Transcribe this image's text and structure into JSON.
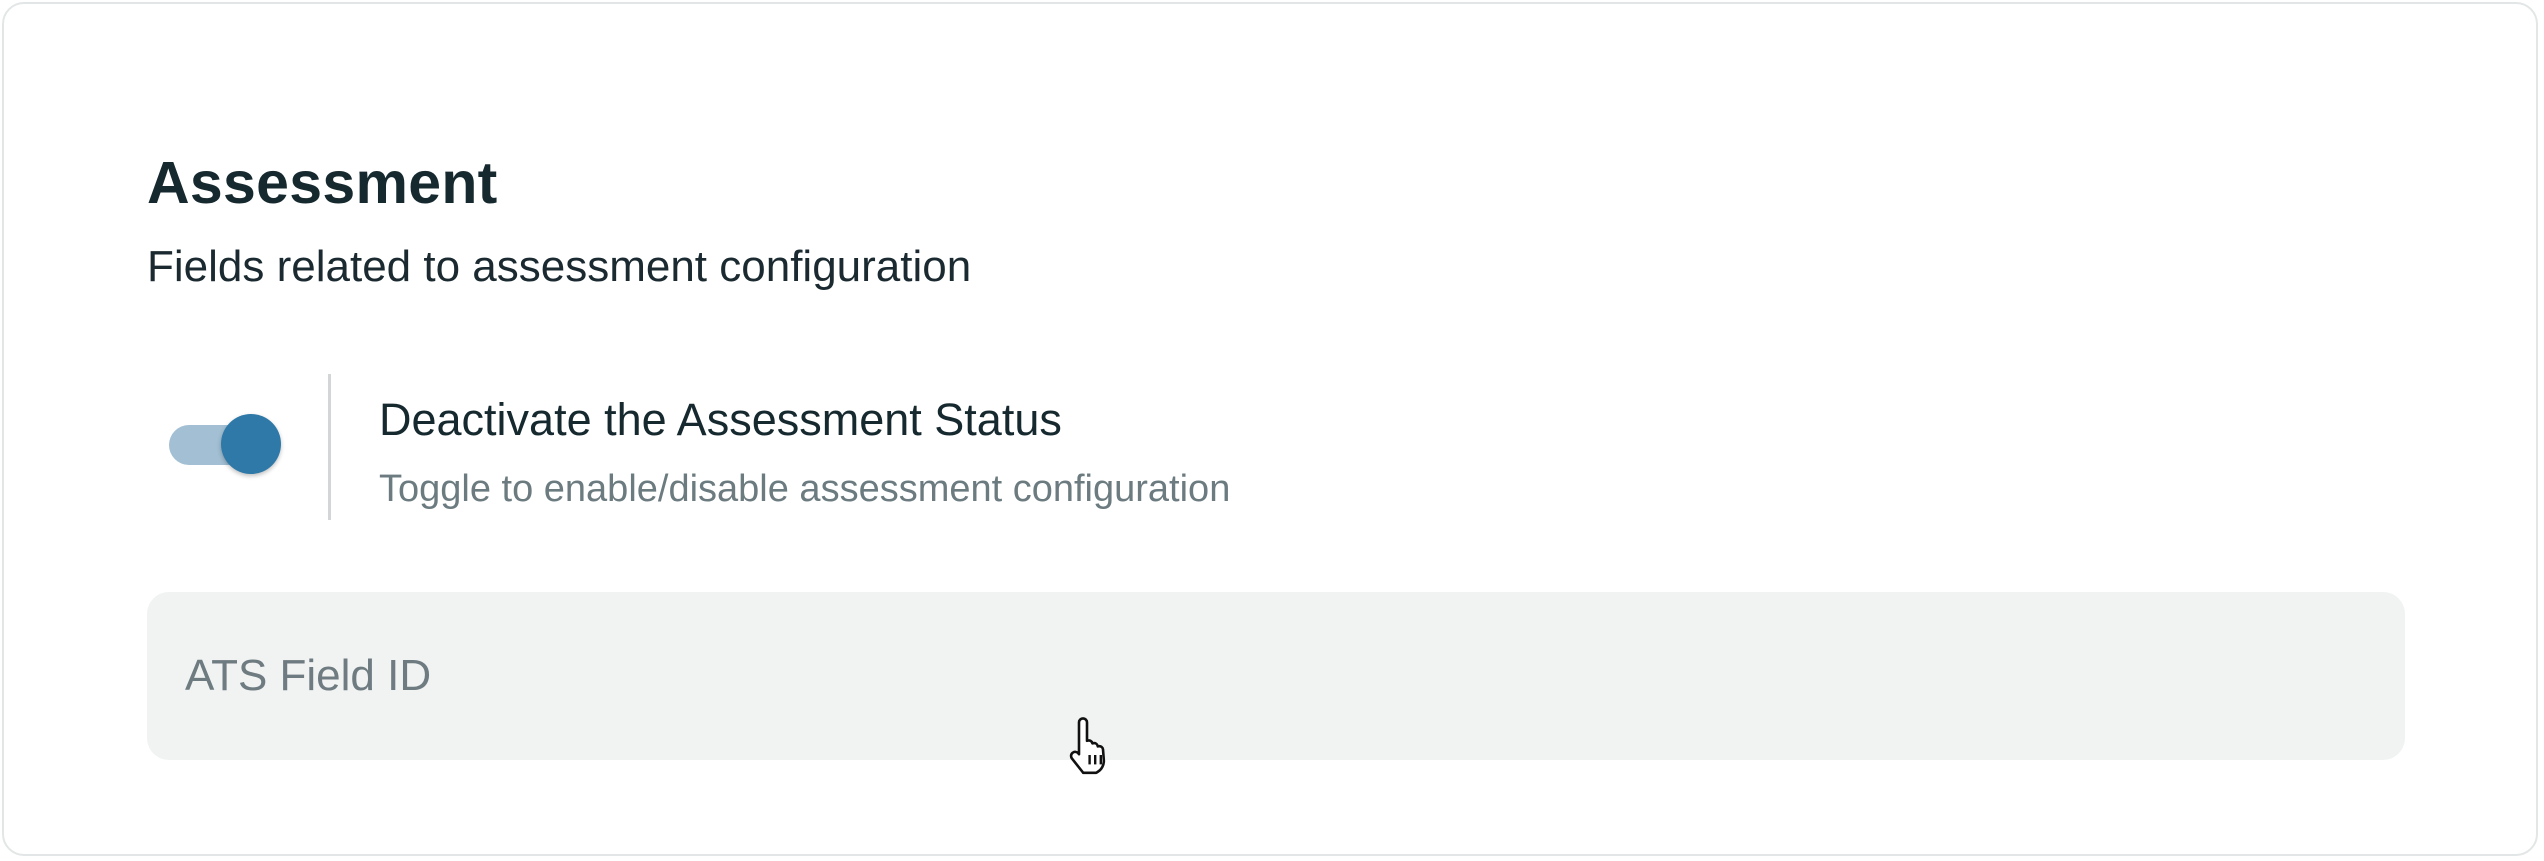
{
  "section": {
    "title": "Assessment",
    "subtitle": "Fields related to assessment configuration"
  },
  "toggle": {
    "label": "Deactivate the Assessment Status",
    "description": "Toggle to enable/disable assessment configuration",
    "checked": true,
    "track_color": "#a2bfd3",
    "thumb_color": "#2e79a8"
  },
  "ats_field": {
    "placeholder": "ATS Field ID",
    "value": ""
  },
  "cursor": {
    "icon": "hand-pointer-icon"
  }
}
